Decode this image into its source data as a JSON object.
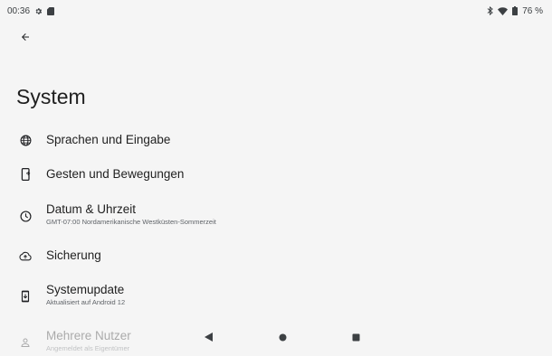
{
  "status": {
    "time": "00:36",
    "battery": "76 %",
    "icons": [
      "gear-icon",
      "sd-card-icon",
      "bluetooth-icon",
      "wifi-icon",
      "battery-icon"
    ]
  },
  "page": {
    "title": "System"
  },
  "items": [
    {
      "label": "Sprachen und Eingabe",
      "icon": "globe-icon"
    },
    {
      "label": "Gesten und Bewegungen",
      "icon": "gesture-phone-icon"
    },
    {
      "label": "Datum & Uhrzeit",
      "sub": "GMT-07:00 Nordamerikanische Westküsten-Sommerzeit",
      "icon": "clock-icon"
    },
    {
      "label": "Sicherung",
      "icon": "cloud-upload-icon"
    },
    {
      "label": "Systemupdate",
      "sub": "Aktualisiert auf Android 12",
      "icon": "system-update-icon"
    },
    {
      "label": "Mehrere Nutzer",
      "sub": "Angemeldet als Eigentümer",
      "icon": "person-icon"
    }
  ],
  "nav": {
    "icons": [
      "back-triangle-icon",
      "home-circle-icon",
      "recents-square-icon"
    ]
  }
}
